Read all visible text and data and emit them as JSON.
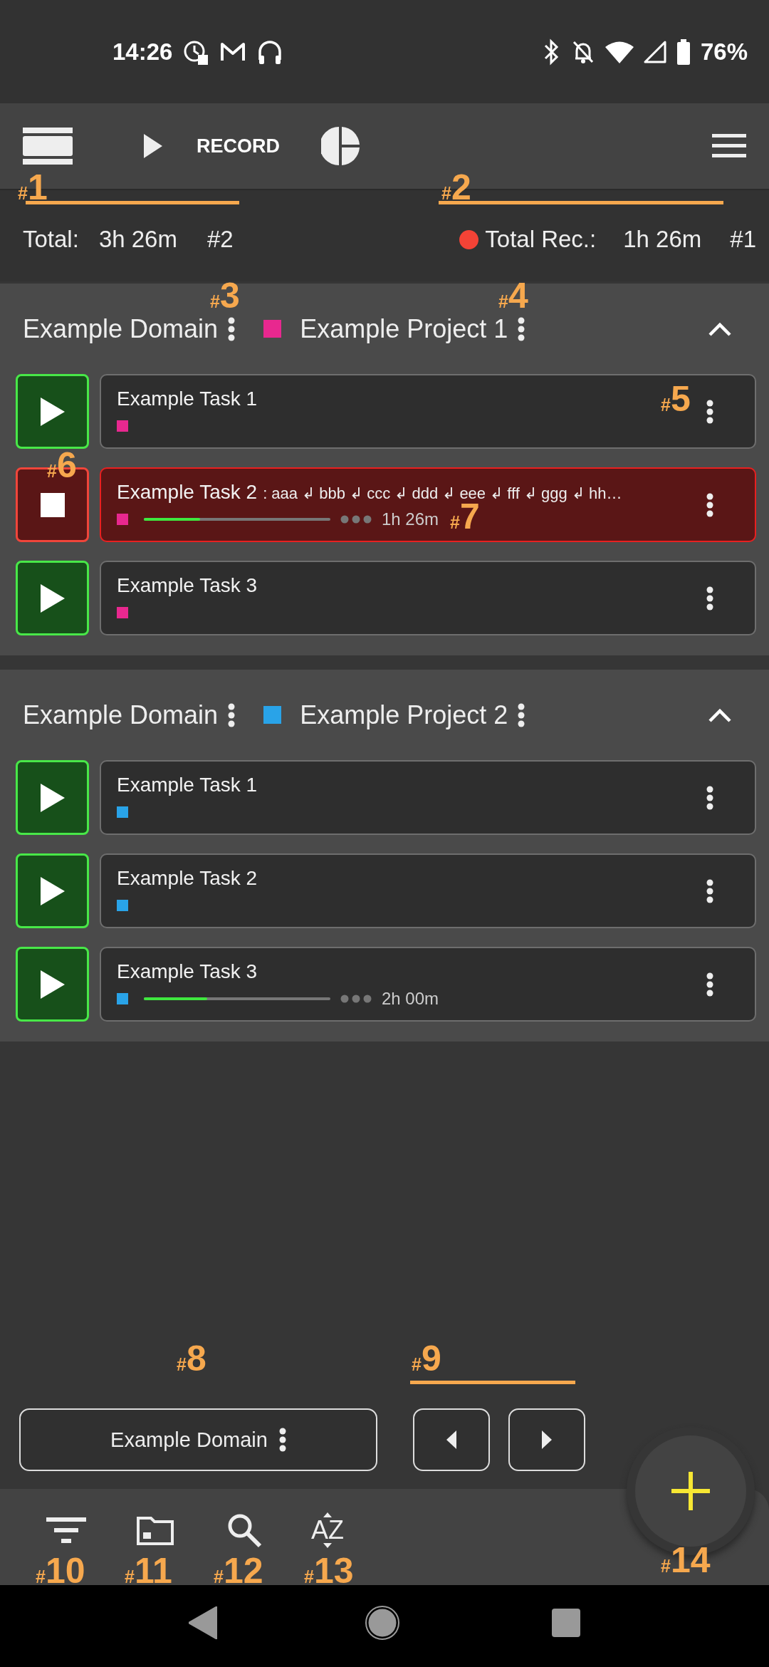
{
  "status_bar": {
    "time": "14:26",
    "battery": "76%"
  },
  "toolbar": {
    "record_label": "RECORD"
  },
  "totals": {
    "total_label": "Total:",
    "total_value": "3h 26m",
    "total_count": "#2",
    "recording_label": "Total Rec.:",
    "recording_value": "1h 26m",
    "recording_count": "#1"
  },
  "groups": [
    {
      "domain": "Example Domain",
      "project": "Example Project 1",
      "color": "#e8288f",
      "expanded": true,
      "tasks": [
        {
          "title": "Example Task 1",
          "recording": false
        },
        {
          "title": "Example Task 2",
          "note": ": aaa ↲ bbb ↲ ccc ↲ ddd ↲ eee ↲ fff ↲ ggg ↲ hh…",
          "recording": true,
          "level": 0.3,
          "duration": "1h 26m"
        },
        {
          "title": "Example Task 3",
          "recording": false
        }
      ]
    },
    {
      "domain": "Example Domain",
      "project": "Example Project 2",
      "color": "#29a3e8",
      "expanded": true,
      "tasks": [
        {
          "title": "Example Task 1",
          "recording": false
        },
        {
          "title": "Example Task 2",
          "recording": false
        },
        {
          "title": "Example Task 3",
          "recording": false,
          "level": 0.34,
          "duration": "2h 00m"
        }
      ]
    }
  ],
  "bottom_controls": {
    "domain_button": "Example Domain"
  },
  "bottom_bar": {
    "sort_label": "AZ"
  },
  "annotations": [
    {
      "label": "#1",
      "underline": true
    },
    {
      "label": "#2",
      "underline": true
    },
    {
      "label": "#3",
      "underline": false
    },
    {
      "label": "#4",
      "underline": false
    },
    {
      "label": "#5",
      "underline": false
    },
    {
      "label": "#6",
      "underline": false
    },
    {
      "label": "#7",
      "underline": false
    },
    {
      "label": "#8",
      "underline": false
    },
    {
      "label": "#9",
      "underline": true
    },
    {
      "label": "#10",
      "underline": false
    },
    {
      "label": "#11",
      "underline": false
    },
    {
      "label": "#12",
      "underline": false
    },
    {
      "label": "#13",
      "underline": false
    },
    {
      "label": "#14",
      "underline": false
    }
  ]
}
